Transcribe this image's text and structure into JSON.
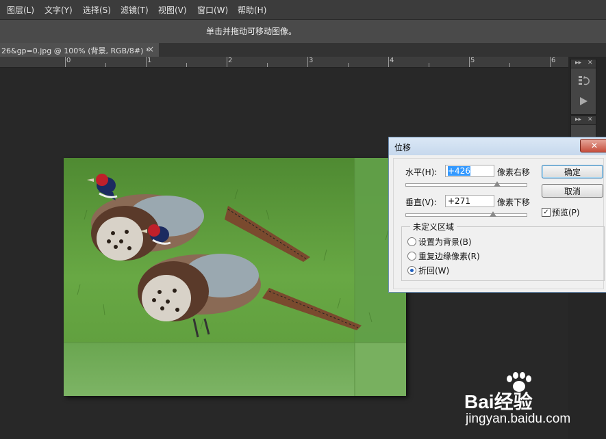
{
  "menubar": {
    "items": [
      "图层(L)",
      "文字(Y)",
      "选择(S)",
      "滤镜(T)",
      "视图(V)",
      "窗口(W)",
      "帮助(H)"
    ]
  },
  "options_bar": {
    "hint": "单击并拖动可移动图像。"
  },
  "document_tab": {
    "title": "26&gp=0.jpg @ 100% (背景, RGB/8#) *",
    "close_glyph": "×"
  },
  "ruler": {
    "labels": [
      "0",
      "1",
      "2",
      "3",
      "4",
      "5",
      "6"
    ]
  },
  "right_panels": {
    "collapse_glyph": "▸▸",
    "close_glyph": "✕"
  },
  "offset_dialog": {
    "title": "位移",
    "close_glyph": "✕",
    "horizontal": {
      "label": "水平(H):",
      "value": "+426",
      "unit": "像素右移",
      "slider_level": 0.76
    },
    "vertical": {
      "label": "垂直(V):",
      "value": "+271",
      "unit": "像素下移",
      "slider_level": 0.73
    },
    "ok_label": "确定",
    "cancel_label": "取消",
    "preview": {
      "label": "预览(P)",
      "checked": true,
      "mark": "✓"
    },
    "undefined_areas": {
      "legend": "未定义区域",
      "options": [
        {
          "label": "设置为背景(B)",
          "selected": false
        },
        {
          "label": "重复边缘像素(R)",
          "selected": false
        },
        {
          "label": "折回(W)",
          "selected": true
        }
      ]
    }
  },
  "watermark": {
    "brand": "Bai经验",
    "url": "jingyan.baidu.com"
  },
  "colors": {
    "workspace_bg": "#282828",
    "menubar_bg": "#3c3c3c",
    "dialog_bg": "#f0f0f0",
    "selection_blue": "#3399ff",
    "grass_green": "#5e9a3a"
  }
}
